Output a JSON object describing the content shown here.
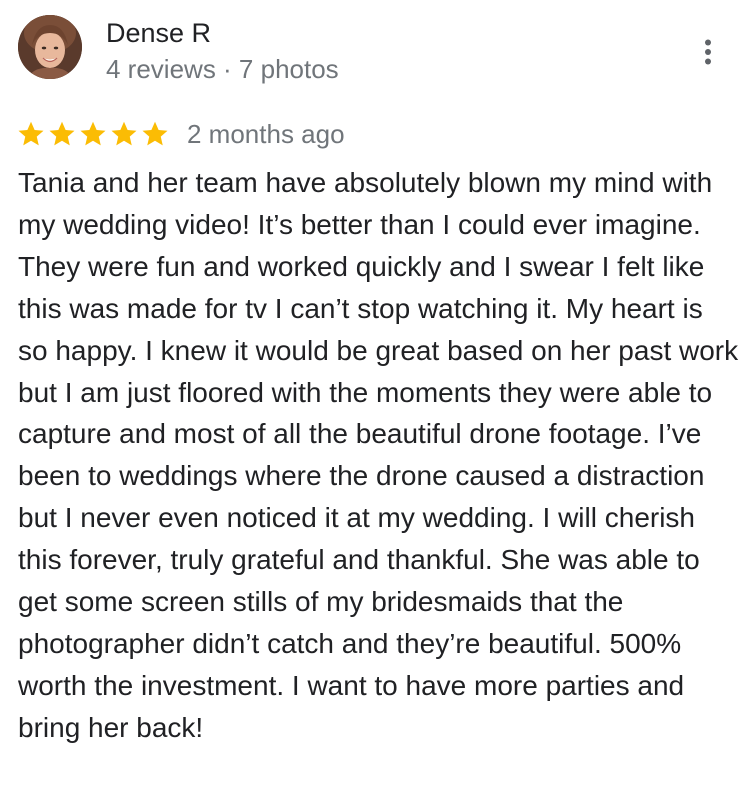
{
  "reviewer": {
    "name": "Dense R",
    "meta": "4 reviews · 7 photos",
    "avatar_icon": "user-photo-avatar"
  },
  "menu": {
    "icon": "more-vertical-icon"
  },
  "review": {
    "rating": 5,
    "rating_max": 5,
    "star_color": "#fbbc04",
    "date": "2 months ago",
    "text": "Tania and her team have absolutely blown my mind with my wedding video! It’s better than I could ever imagine. They were fun and worked quickly and I swear I felt like this was made for tv I can’t stop watching it. My heart is so happy. I knew it would be great based on her past work but I am just floored with the moments they were able to capture and most of all the beautiful drone footage. I’ve been to weddings where the drone caused a distraction but I never even noticed it at my wedding. I will cherish this forever, truly grateful and thankful. She was able to get some screen stills of my bridesmaids that the photographer didn’t catch and they’re beautiful. 500% worth the investment. I want to have more parties and bring her back!"
  }
}
